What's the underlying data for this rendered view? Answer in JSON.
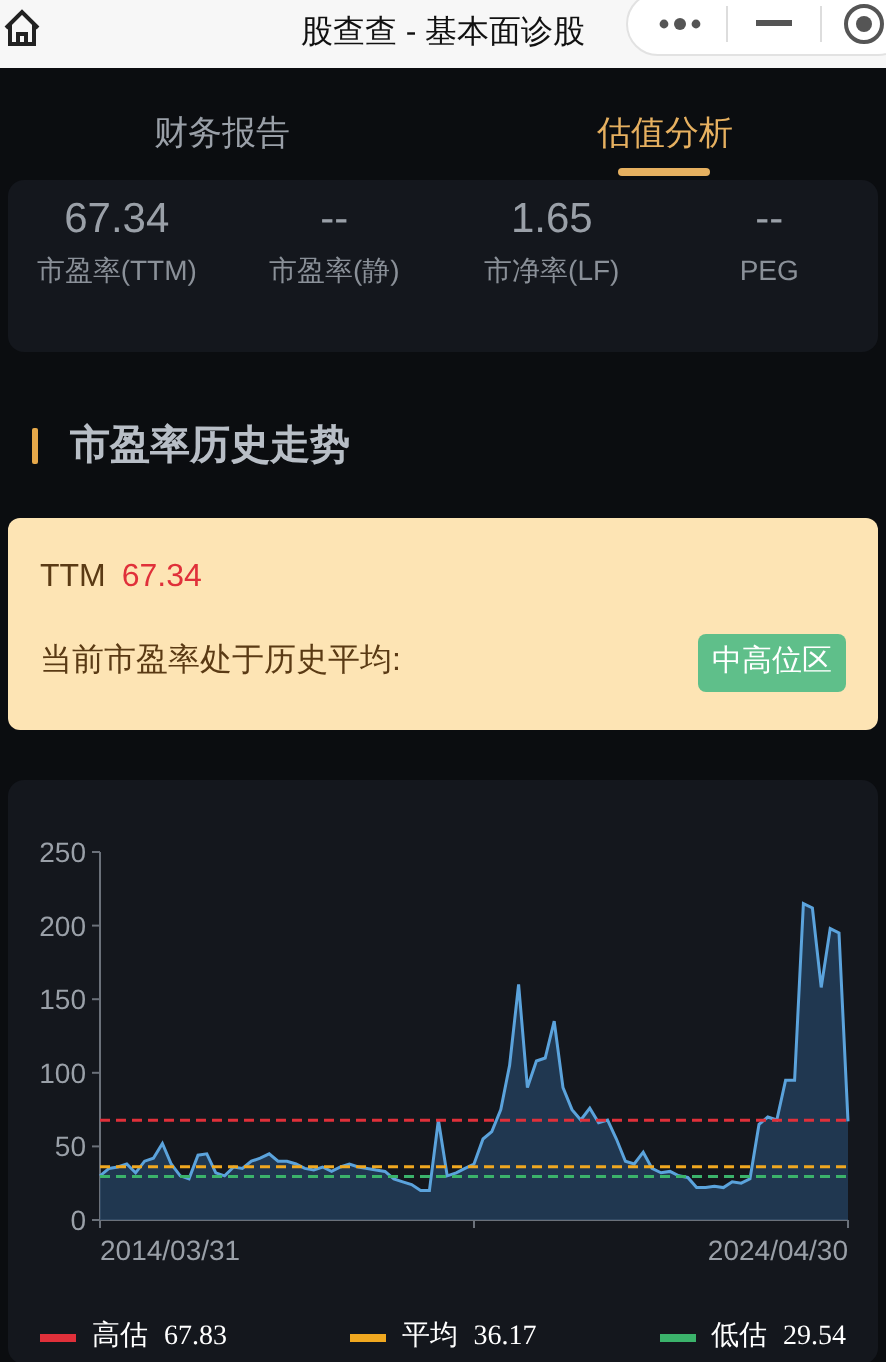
{
  "window": {
    "title": "股查查 - 基本面诊股"
  },
  "tabs": [
    {
      "label": "财务报告",
      "selected": false
    },
    {
      "label": "估值分析",
      "selected": true
    }
  ],
  "metrics": [
    {
      "value": "67.34",
      "label": "市盈率(TTM)"
    },
    {
      "value": "--",
      "label": "市盈率(静)"
    },
    {
      "value": "1.65",
      "label": "市净率(LF)"
    },
    {
      "value": "--",
      "label": "PEG"
    }
  ],
  "section_title": "市盈率历史走势",
  "summary": {
    "ttm_label": "TTM",
    "ttm_value": "67.34",
    "text": "当前市盈率处于历史平均:",
    "badge": "中高位区"
  },
  "chart": {
    "chart_data": {
      "type": "area",
      "series": [
        {
          "color": "#5ba3dc",
          "values": [
            30,
            35,
            36,
            38,
            32,
            40,
            42,
            52,
            38,
            30,
            28,
            44,
            45,
            32,
            30,
            36,
            35,
            40,
            42,
            45,
            40,
            40,
            38,
            35,
            34,
            36,
            33,
            36,
            38,
            36,
            35,
            34,
            33,
            28,
            26,
            24,
            20,
            20,
            68,
            30,
            32,
            35,
            38,
            55,
            60,
            75,
            105,
            160,
            90,
            108,
            110,
            135,
            90,
            75,
            68,
            76,
            66,
            68,
            55,
            40,
            38,
            46,
            35,
            32,
            33,
            30,
            29,
            22,
            22,
            23,
            22,
            26,
            25,
            28,
            65,
            70,
            68,
            95,
            95,
            215,
            212,
            158,
            198,
            195,
            67
          ]
        },
        {
          "color": "#e0303a",
          "type": "line",
          "line_style": "dashed",
          "values": [
            67.83,
            67.83,
            67.83,
            67.83,
            67.83,
            67.83,
            67.83,
            67.83,
            67.83,
            67.83,
            67.83,
            67.83,
            67.83,
            67.83,
            67.83,
            67.83,
            67.83,
            67.83,
            67.83,
            67.83,
            67.83,
            67.83,
            67.83,
            67.83,
            67.83,
            67.83,
            67.83,
            67.83,
            67.83,
            67.83,
            67.83,
            67.83,
            67.83,
            67.83,
            67.83,
            67.83,
            67.83,
            67.83,
            67.83,
            67.83,
            67.83,
            67.83,
            67.83,
            67.83,
            67.83,
            67.83,
            67.83,
            67.83,
            67.83,
            67.83,
            67.83,
            67.83,
            67.83,
            67.83,
            67.83,
            67.83,
            67.83,
            67.83,
            67.83,
            67.83,
            67.83,
            67.83,
            67.83,
            67.83,
            67.83,
            67.83,
            67.83,
            67.83,
            67.83,
            67.83,
            67.83,
            67.83,
            67.83,
            67.83,
            67.83,
            67.83,
            67.83,
            67.83,
            67.83,
            67.83,
            67.83,
            67.83,
            67.83,
            67.83,
            67.83
          ]
        },
        {
          "color": "#f0a820",
          "type": "line",
          "line_style": "dashed",
          "values": [
            36.17,
            36.17,
            36.17,
            36.17,
            36.17,
            36.17,
            36.17,
            36.17,
            36.17,
            36.17,
            36.17,
            36.17,
            36.17,
            36.17,
            36.17,
            36.17,
            36.17,
            36.17,
            36.17,
            36.17,
            36.17,
            36.17,
            36.17,
            36.17,
            36.17,
            36.17,
            36.17,
            36.17,
            36.17,
            36.17,
            36.17,
            36.17,
            36.17,
            36.17,
            36.17,
            36.17,
            36.17,
            36.17,
            36.17,
            36.17,
            36.17,
            36.17,
            36.17,
            36.17,
            36.17,
            36.17,
            36.17,
            36.17,
            36.17,
            36.17,
            36.17,
            36.17,
            36.17,
            36.17,
            36.17,
            36.17,
            36.17,
            36.17,
            36.17,
            36.17,
            36.17,
            36.17,
            36.17,
            36.17,
            36.17,
            36.17,
            36.17,
            36.17,
            36.17,
            36.17,
            36.17,
            36.17,
            36.17,
            36.17,
            36.17,
            36.17,
            36.17,
            36.17,
            36.17,
            36.17,
            36.17,
            36.17,
            36.17,
            36.17,
            36.17
          ]
        },
        {
          "color": "#3bb36b",
          "type": "line",
          "line_style": "dashed",
          "values": [
            29.54,
            29.54,
            29.54,
            29.54,
            29.54,
            29.54,
            29.54,
            29.54,
            29.54,
            29.54,
            29.54,
            29.54,
            29.54,
            29.54,
            29.54,
            29.54,
            29.54,
            29.54,
            29.54,
            29.54,
            29.54,
            29.54,
            29.54,
            29.54,
            29.54,
            29.54,
            29.54,
            29.54,
            29.54,
            29.54,
            29.54,
            29.54,
            29.54,
            29.54,
            29.54,
            29.54,
            29.54,
            29.54,
            29.54,
            29.54,
            29.54,
            29.54,
            29.54,
            29.54,
            29.54,
            29.54,
            29.54,
            29.54,
            29.54,
            29.54,
            29.54,
            29.54,
            29.54,
            29.54,
            29.54,
            29.54,
            29.54,
            29.54,
            29.54,
            29.54,
            29.54,
            29.54,
            29.54,
            29.54,
            29.54,
            29.54,
            29.54,
            29.54,
            29.54,
            29.54,
            29.54,
            29.54,
            29.54,
            29.54,
            29.54,
            29.54,
            29.54,
            29.54,
            29.54,
            29.54,
            29.54,
            29.54,
            29.54,
            29.54,
            29.54
          ]
        }
      ],
      "ylim": [
        0,
        250
      ],
      "yticks": [
        0,
        50,
        100,
        150,
        200,
        250
      ]
    },
    "x_labels": [
      "2014/03/31",
      "2024/04/30"
    ],
    "legend": [
      {
        "label": "高估",
        "value": "67.83",
        "color": "#e0303a"
      },
      {
        "label": "平均",
        "value": "36.17",
        "color": "#f0a820"
      },
      {
        "label": "低估",
        "value": "29.54",
        "color": "#3bb36b"
      }
    ]
  }
}
